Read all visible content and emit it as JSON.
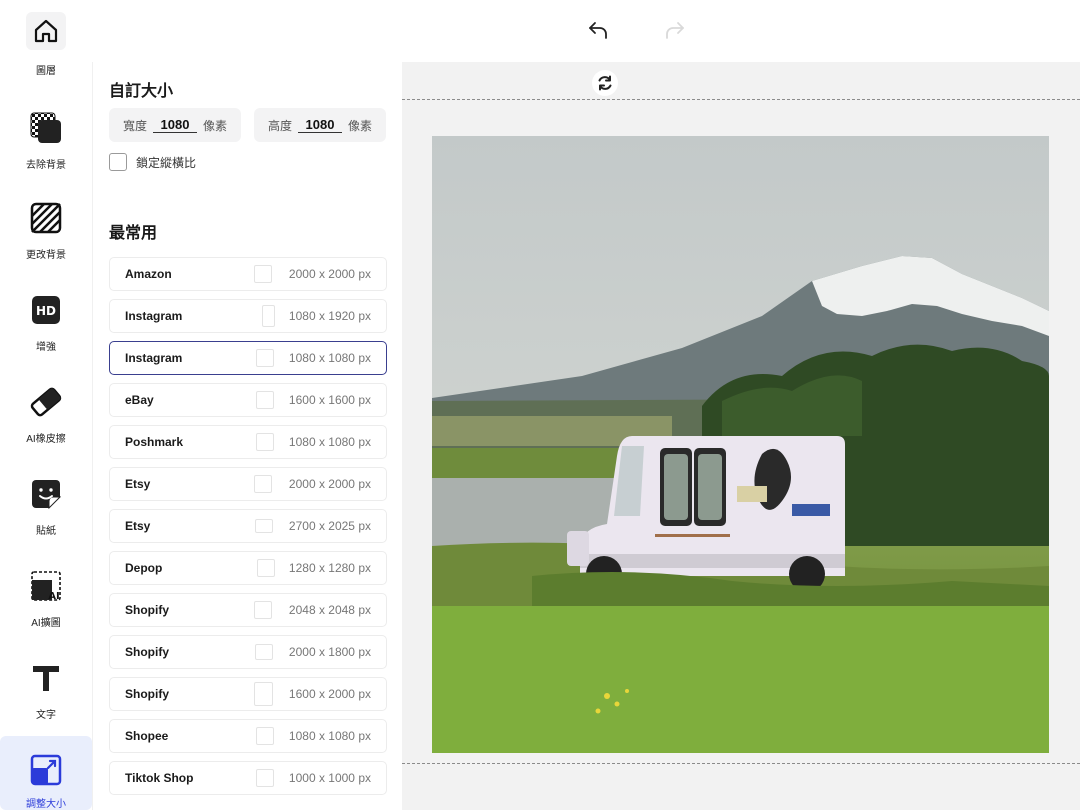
{
  "toolbar": {
    "undo_icon": "undo-arrow-icon",
    "redo_icon": "redo-arrow-icon"
  },
  "rail": {
    "items": [
      {
        "label": "圖層",
        "icon": "home-icon"
      },
      {
        "label": "去除背景",
        "icon": "remove-background-icon"
      },
      {
        "label": "更改背景",
        "icon": "change-background-icon"
      },
      {
        "label": "增強",
        "icon": "hd-icon"
      },
      {
        "label": "AI橡皮擦",
        "icon": "eraser-icon"
      },
      {
        "label": "貼紙",
        "icon": "sticker-icon"
      },
      {
        "label": "AI擴圖",
        "icon": "ai-expand-icon"
      },
      {
        "label": "文字",
        "icon": "text-icon"
      },
      {
        "label": "調整大小",
        "icon": "resize-icon",
        "active": true
      }
    ]
  },
  "panel": {
    "title": "自訂大小",
    "width_label": "寬度",
    "width_value": "1080",
    "width_unit": "像素",
    "height_label": "高度",
    "height_value": "1080",
    "height_unit": "像素",
    "lock_label": "鎖定縱橫比",
    "section_title": "最常用",
    "presets": [
      {
        "name": "Amazon",
        "size": "2000 x 2000 px"
      },
      {
        "name": "Instagram",
        "size": "1080 x 1920 px"
      },
      {
        "name": "Instagram",
        "size": "1080 x 1080 px",
        "selected": true
      },
      {
        "name": "eBay",
        "size": "1600 x 1600 px"
      },
      {
        "name": "Poshmark",
        "size": "1080 x 1080 px"
      },
      {
        "name": "Etsy",
        "size": "2000 x 2000 px"
      },
      {
        "name": "Etsy",
        "size": "2700 x 2025 px"
      },
      {
        "name": "Depop",
        "size": "1280 x 1280 px"
      },
      {
        "name": "Shopify",
        "size": "2048 x 2048 px"
      },
      {
        "name": "Shopify",
        "size": "2000 x 1800 px"
      },
      {
        "name": "Shopify",
        "size": "1600 x 2000 px"
      },
      {
        "name": "Shopee",
        "size": "1080 x 1080 px"
      },
      {
        "name": "Tiktok Shop",
        "size": "1000 x 1000 px"
      }
    ]
  },
  "colors": {
    "accent": "#2b3bd9",
    "selected_border": "#3a3f8f"
  }
}
